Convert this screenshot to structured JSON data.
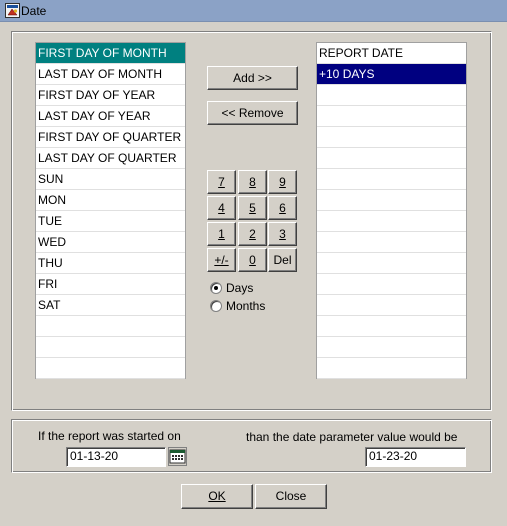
{
  "window": {
    "title": "Date"
  },
  "left_list": {
    "items": [
      "FIRST DAY OF MONTH",
      "LAST DAY OF MONTH",
      "FIRST DAY OF YEAR",
      "LAST DAY OF YEAR",
      "FIRST DAY OF QUARTER",
      "LAST DAY OF QUARTER",
      "SUN",
      "MON",
      "TUE",
      "WED",
      "THU",
      "FRI",
      "SAT"
    ],
    "selected_index": 0,
    "selected_color": "#008080"
  },
  "right_list": {
    "items": [
      "REPORT DATE",
      "+10 DAYS"
    ],
    "selected_index": 1,
    "selected_color": "#000080"
  },
  "buttons": {
    "add": "Add >>",
    "remove": "<< Remove",
    "ok": "OK",
    "close": "Close"
  },
  "keypad": {
    "k7": "7",
    "k8": "8",
    "k9": "9",
    "k4": "4",
    "k5": "5",
    "k6": "6",
    "k1": "1",
    "k2": "2",
    "k3": "3",
    "plusminus": "+/-",
    "k0": "0",
    "del": "Del"
  },
  "unit": {
    "days": "Days",
    "months": "Months",
    "selected": "Days"
  },
  "example": {
    "started_caption": "If the report  was started on",
    "result_caption": "than the date parameter  value would be",
    "start_date": "01-13-20",
    "result_date": "01-23-20"
  },
  "icons": {
    "title": "app-window-icon",
    "calendar": "calendar-icon"
  }
}
